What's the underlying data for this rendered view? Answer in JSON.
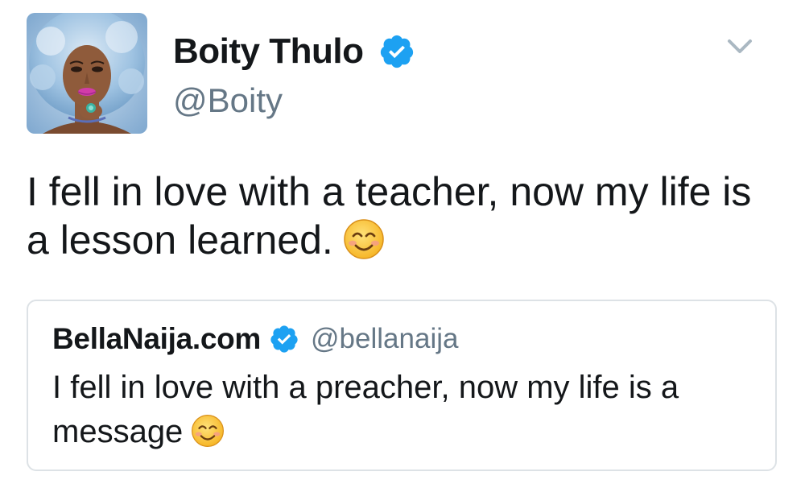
{
  "tweet": {
    "author": {
      "display_name": "Boity Thulo",
      "handle": "@Boity",
      "verified": true,
      "avatar_icon": "profile-photo"
    },
    "text": "I fell in love with a teacher, now my life is a lesson learned.",
    "emoji": "smiling-face-with-smiling-eyes",
    "menu_icon": "chevron-down-icon",
    "quoted_tweet": {
      "display_name": "BellaNaija.com",
      "handle": "@bellanaija",
      "verified": true,
      "text": "I fell in love with a preacher, now my life is a message",
      "emoji": "smiling-face-with-smiling-eyes"
    }
  },
  "colors": {
    "text_primary": "#14171a",
    "text_secondary": "#657786",
    "verified_blue": "#1da1f2",
    "card_border": "#dde2e6",
    "caret_gray": "#aab8c2"
  }
}
